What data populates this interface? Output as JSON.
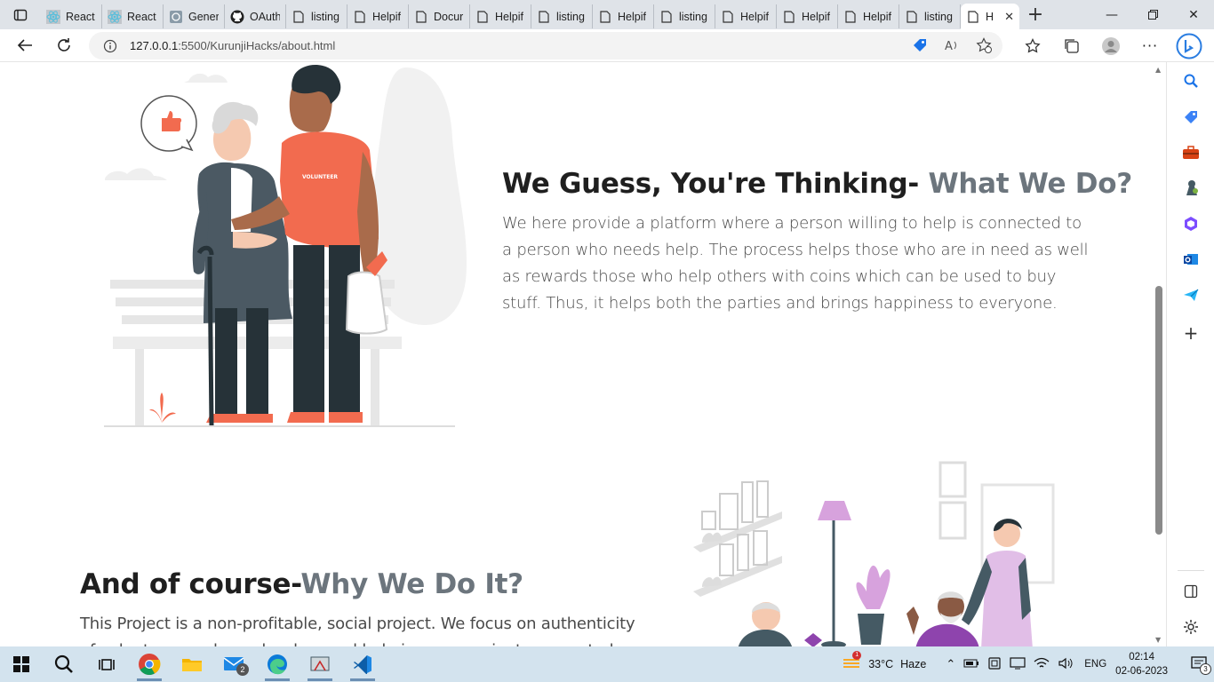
{
  "browser": {
    "tabs": [
      {
        "title": "React",
        "icon": "react-icon"
      },
      {
        "title": "React",
        "icon": "react-icon"
      },
      {
        "title": "Gener",
        "icon": "app-icon"
      },
      {
        "title": "OAuth",
        "icon": "github-icon"
      },
      {
        "title": "listing",
        "icon": "page-icon"
      },
      {
        "title": "Helpif",
        "icon": "page-icon"
      },
      {
        "title": "Docur",
        "icon": "page-icon"
      },
      {
        "title": "Helpif",
        "icon": "page-icon"
      },
      {
        "title": "listing",
        "icon": "page-icon"
      },
      {
        "title": "Helpif",
        "icon": "page-icon"
      },
      {
        "title": "listing",
        "icon": "page-icon"
      },
      {
        "title": "Helpif",
        "icon": "page-icon"
      },
      {
        "title": "Helpif",
        "icon": "page-icon"
      },
      {
        "title": "Helpif",
        "icon": "page-icon"
      },
      {
        "title": "listing",
        "icon": "page-icon"
      }
    ],
    "active_tab": {
      "title": "H",
      "icon": "page-icon"
    },
    "url_host": "127.0.0.1",
    "url_path": ":5500/KurunjiHacks/about.html"
  },
  "page": {
    "section1": {
      "heading_main": "We Guess, You're Thinking- ",
      "heading_accent": "What We Do?",
      "body": "We here provide a platform where a person willing to help is connected to a person who needs help. The process helps those who are in need as well as rewards those who help others with coins which can be used to buy stuff. Thus, it helps both the parties and brings happiness to everyone.",
      "illustration_label": "VOLUNTEER"
    },
    "section2": {
      "heading_main": "And of course-",
      "heading_accent": "Why We Do It?",
      "body": "This Project is a non-profitable, social project. We focus on authenticity of volunteers and people who need help in a convenient, connected world. This"
    }
  },
  "taskbar": {
    "weather_temp": "33°C",
    "weather_text": "Haze",
    "mail_badge": "2",
    "language": "ENG",
    "time": "02:14",
    "date": "02-06-2023",
    "notification_count": "3",
    "weather_alert": "1"
  },
  "colors": {
    "accent_text": "#6c757d",
    "volunteer_orange": "#f26b4f",
    "taskbar_bg": "#d3e3ee",
    "tabbar_bg": "#dfe3e8"
  }
}
